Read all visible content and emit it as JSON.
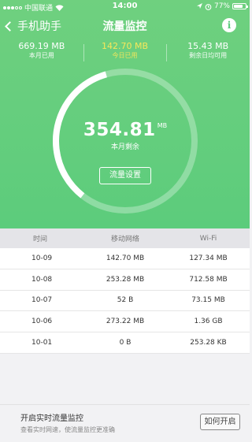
{
  "status_bar": {
    "carrier": "中国联通",
    "time": "14:00",
    "battery": "77%",
    "battery_level": 0.77
  },
  "nav": {
    "back_label": "手机助手",
    "title": "流量监控"
  },
  "stats": {
    "monthly_used": {
      "value": "669.19 MB",
      "label": "本月已用"
    },
    "today_used": {
      "value": "142.70 MB",
      "label": "今日已用"
    },
    "daily_available": {
      "value": "15.43 MB",
      "label": "剩余日均可用"
    }
  },
  "ring": {
    "remaining_value": "354.81",
    "remaining_unit": "MB",
    "remaining_label": "本月剩余",
    "remaining_fraction": 0.35,
    "settings_button": "流量设置"
  },
  "table": {
    "headers": [
      "时间",
      "移动网络",
      "Wi-Fi"
    ],
    "rows": [
      [
        "10-09",
        "142.70 MB",
        "127.34 MB"
      ],
      [
        "10-08",
        "253.28 MB",
        "712.58 MB"
      ],
      [
        "10-07",
        "52 B",
        "73.15 MB"
      ],
      [
        "10-06",
        "273.22 MB",
        "1.36 GB"
      ],
      [
        "10-01",
        "0 B",
        "253.28 KB"
      ]
    ]
  },
  "bottom": {
    "title": "开启实时流量监控",
    "subtitle": "查看实时网速，使流量监控更准确",
    "button": "如何开启"
  },
  "colors": {
    "accent": "#5ccc7c",
    "highlight": "#f6e75a"
  }
}
